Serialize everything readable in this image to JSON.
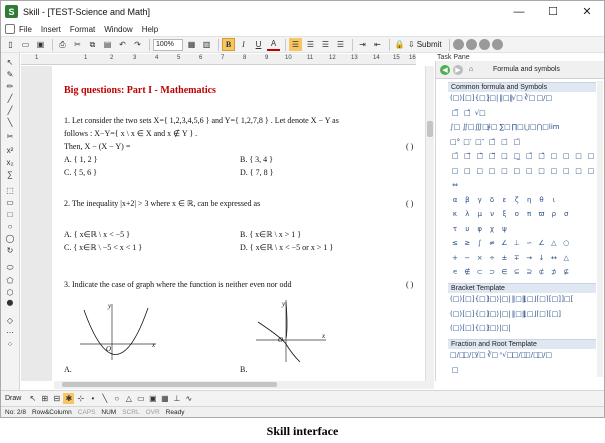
{
  "window": {
    "title": "Skill - [TEST-Science and Math]",
    "app_icon_letter": "S",
    "controls": [
      "—",
      "☐",
      "✕"
    ]
  },
  "menu": [
    "File",
    "Insert",
    "Format",
    "Window",
    "Help"
  ],
  "toolbar": {
    "zoom": "100%",
    "bold": "B",
    "italic": "I",
    "underline": "U",
    "font_color": "A",
    "submit": "Submit"
  },
  "task_pane": {
    "label": "Task Pane",
    "panel_title": "Formula and symbols",
    "sections": [
      {
        "title": "Common formula and Symbols",
        "rows": [
          [
            "(□)",
            "[□]",
            "{□}",
            "|□|",
            "‖□‖",
            "√□",
            "∛□",
            "□/□",
            "",
            "",
            "",
            ""
          ],
          [
            "□̅",
            "□̂",
            "√□",
            "",
            "",
            "",
            "",
            "",
            "",
            "",
            "",
            ""
          ],
          [
            "∫□",
            "∬□",
            "∭□",
            "∮□",
            "∑□",
            "∏□",
            "⋃□",
            "⋂□",
            "lim",
            "",
            "",
            ""
          ],
          [
            "□°",
            "□′",
            "□″",
            "□̃",
            "□̇",
            "□̈",
            "",
            "",
            "",
            "",
            "",
            ""
          ],
          [
            "□̄",
            "□⃗",
            "□⃖",
            "□⃡",
            "□̱",
            "□̲",
            "□̌",
            "□̆",
            "□",
            "□",
            "□",
            "□"
          ],
          [
            "□",
            "□",
            "□",
            "□",
            "□",
            "□",
            "□",
            "□",
            "□",
            "□",
            "□",
            "□"
          ],
          [
            "⇔",
            "",
            "",
            "",
            "",
            "",
            "",
            "",
            "",
            "",
            "",
            ""
          ],
          [
            "α",
            "β",
            "γ",
            "δ",
            "ε",
            "ζ",
            "η",
            "θ",
            "ι",
            "",
            "",
            ""
          ],
          [
            "κ",
            "λ",
            "μ",
            "ν",
            "ξ",
            "ο",
            "π",
            "ϖ",
            "ρ",
            "σ",
            "",
            ""
          ],
          [
            "τ",
            "υ",
            "φ",
            "χ",
            "ψ",
            "",
            "",
            "",
            "",
            "",
            "",
            ""
          ],
          [
            "≤",
            "≥",
            "∫",
            "≠",
            "∠",
            "⊥",
            "∽",
            "∠",
            "△",
            "○",
            "",
            ""
          ],
          [
            "+",
            "−",
            "×",
            "÷",
            "±",
            "∓",
            "→",
            "↓",
            "↔",
            "△",
            "",
            ""
          ],
          [
            "∊",
            "∉",
            "⊂",
            "⊃",
            "∈",
            "⊆",
            "⊇",
            "⊄",
            "⊅",
            "⊈",
            "",
            ""
          ]
        ]
      },
      {
        "title": "Bracket Template",
        "rows": [
          [
            "(□)",
            "[□]",
            "{□}",
            "⟨□⟩",
            "|□|",
            "‖□‖",
            "⌊□⌋",
            "⌈□⌉",
            "[□]",
            "]□[",
            "",
            ""
          ],
          [
            "(□)",
            "[□]",
            "{□}",
            "⟨□⟩",
            "|□|",
            "‖□‖",
            "⌊□⌋",
            "⌈□⌉",
            "[□]",
            "",
            "",
            ""
          ],
          [
            "(□)",
            "[□]",
            "{□}",
            "⟨□⟩",
            "|□|",
            "",
            "",
            "",
            "",
            "",
            "",
            ""
          ]
        ]
      },
      {
        "title": "Fraction and Root Template",
        "rows": [
          [
            "□/□",
            "□/□",
            "√□",
            "∛□",
            "ⁿ√□",
            "□/□",
            "□/□",
            "□/□",
            "",
            "",
            "",
            ""
          ],
          [
            "□",
            "",
            "",
            "",
            "",
            "",
            "",
            "",
            "",
            "",
            "",
            ""
          ]
        ]
      }
    ]
  },
  "ruler": [
    "1",
    "1",
    "2",
    "3",
    "4",
    "5",
    "6",
    "7",
    "8",
    "9",
    "10",
    "11",
    "12",
    "13",
    "14",
    "15",
    "16"
  ],
  "document": {
    "heading": "Big questions: Part I - Mathematics",
    "q1": {
      "line1": "1.   Let consider the two sets X={ 1,2,3,4,5,6 }  and  Y={ 1,2,7,8 } . Let denote X − Y as",
      "line2": "follows : X−Y={ x \\ x ∈ X and x ∉ Y } .",
      "line3": "Then,   X − (X − Y) =",
      "paren": "( )",
      "options": [
        "A. { 1, 2 }",
        "B. { 3, 4 }",
        "C. { 5, 6 }",
        "D. { 7, 8 }"
      ]
    },
    "q2": {
      "line1": "2.   The inequality  |x+2| > 3 where x ∈ ℝ, can be expressed as",
      "paren": "( )",
      "options": [
        "A. { x∈ℝ \\ x < −5 }",
        "B. { x∈ℝ \\ x > 1 }",
        "C. { x∈ℝ \\ −5 < x < 1 }",
        "D. { x∈ℝ \\ x < −5  or x > 1 }"
      ]
    },
    "q3": {
      "line1": "3.   Indicate the case of graph where the function is neither even nor odd",
      "paren": "( )",
      "options": [
        "A.",
        "B."
      ],
      "axis_labels": [
        "y",
        "x",
        "O",
        "y",
        "x",
        "O"
      ]
    }
  },
  "drawbar": {
    "label": "Draw"
  },
  "status": {
    "page": "No: 2/8",
    "mode": "Row&Column",
    "indicators": [
      "CAPS",
      "NUM",
      "SCRL",
      "OVR"
    ],
    "active_indicators": [
      "NUM"
    ],
    "state": "Ready"
  },
  "caption": "Skill interface",
  "colors": {
    "heading": "#c00000",
    "accent_bold": "#f7c561",
    "section_bg": "#dfe7f2",
    "app_icon": "#2e7d32"
  }
}
